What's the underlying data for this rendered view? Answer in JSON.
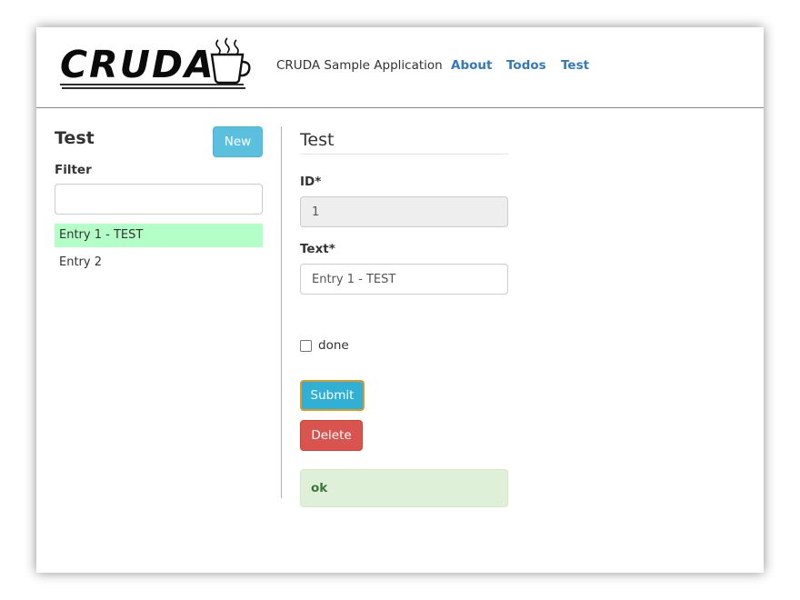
{
  "header": {
    "logo_text": "CRUDA",
    "app_title": "CRUDA Sample Application",
    "nav": [
      {
        "label": "About"
      },
      {
        "label": "Todos"
      },
      {
        "label": "Test"
      }
    ]
  },
  "sidebar": {
    "title": "Test",
    "new_button": "New",
    "filter_label": "Filter",
    "filter_value": "",
    "items": [
      {
        "label": "Entry 1 - TEST",
        "selected": true
      },
      {
        "label": "Entry 2",
        "selected": false
      }
    ]
  },
  "form": {
    "title": "Test",
    "id_label": "ID*",
    "id_value": "1",
    "text_label": "Text*",
    "text_value": "Entry 1 - TEST",
    "done_label": "done",
    "done_checked": false,
    "submit_label": "Submit",
    "delete_label": "Delete",
    "status_message": "ok"
  },
  "colors": {
    "link": "#337ab7",
    "selected_row": "#b4ffc8",
    "new_button": "#5bc0de",
    "submit_button": "#31b0d5",
    "delete_button": "#d9534f",
    "alert_bg": "#dff0d8"
  },
  "icons": {
    "logo": "coffee-cup-icon"
  }
}
